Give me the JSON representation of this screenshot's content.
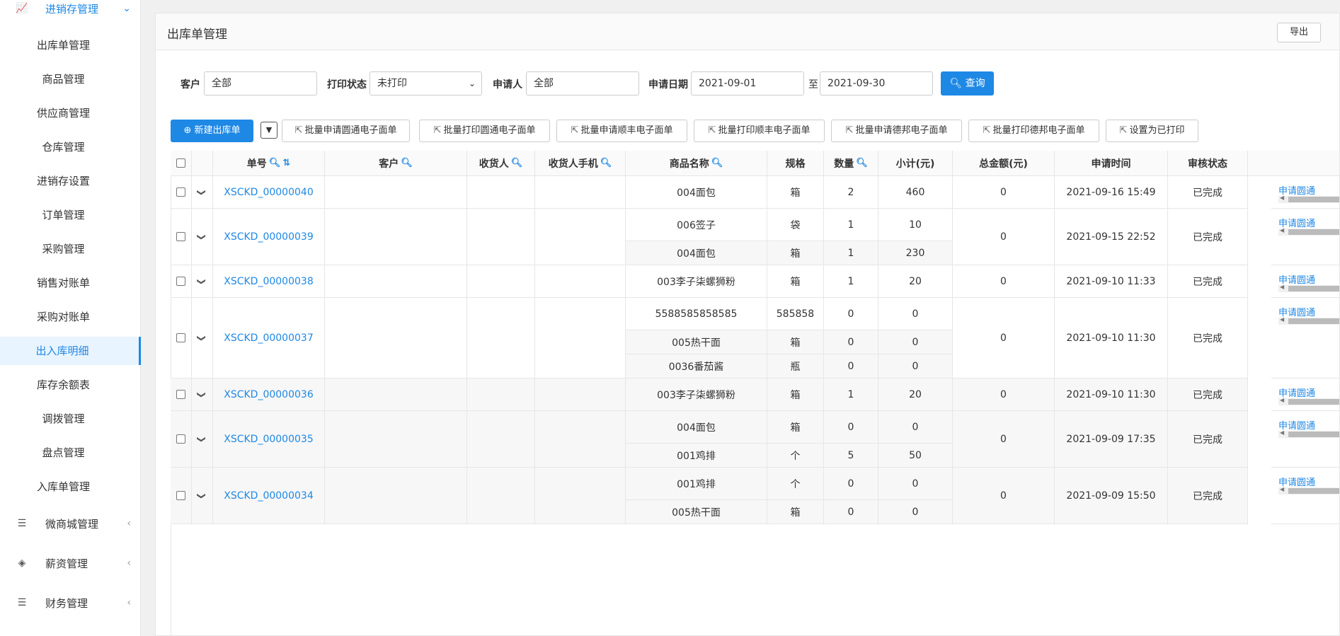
{
  "sidebar": {
    "top_group": {
      "label": "进销存管理",
      "icon": "chart-line-icon"
    },
    "items": [
      {
        "label": "出库单管理"
      },
      {
        "label": "商品管理"
      },
      {
        "label": "供应商管理"
      },
      {
        "label": "仓库管理"
      },
      {
        "label": "进销存设置"
      },
      {
        "label": "订单管理"
      },
      {
        "label": "采购管理"
      },
      {
        "label": "销售对账单"
      },
      {
        "label": "采购对账单"
      },
      {
        "label": "出入库明细",
        "active": true
      },
      {
        "label": "库存余额表"
      },
      {
        "label": "调拨管理"
      },
      {
        "label": "盘点管理"
      },
      {
        "label": "入库单管理"
      }
    ],
    "groups": [
      {
        "label": "微商城管理",
        "icon": "list-icon"
      },
      {
        "label": "薪资管理",
        "icon": "box-icon"
      },
      {
        "label": "财务管理",
        "icon": "list-icon"
      }
    ]
  },
  "panel": {
    "title": "出库单管理",
    "export_label": "导出"
  },
  "filters": {
    "customer_label": "客户",
    "customer_value": "全部",
    "print_label": "打印状态",
    "print_value": "未打印",
    "applicant_label": "申请人",
    "applicant_value": "全部",
    "date_label": "申请日期",
    "date_from": "2021-09-01",
    "date_to_label": "至",
    "date_to": "2021-09-30",
    "query_label": "查询"
  },
  "actions": {
    "new_label": "新建出库单",
    "buttons": [
      "批量申请圆通电子面单",
      "批量打印圆通电子面单",
      "批量申请顺丰电子面单",
      "批量打印顺丰电子面单",
      "批量申请德邦电子面单",
      "批量打印德邦电子面单",
      "设置为已打印"
    ]
  },
  "table": {
    "headers": {
      "no": "单号",
      "customer": "客户",
      "receiver": "收货人",
      "phone": "收货人手机",
      "product": "商品名称",
      "spec": "规格",
      "qty": "数量",
      "subtotal": "小计(元)",
      "total": "总金额(元)",
      "time": "申请时间",
      "status": "审核状态"
    },
    "op_label": "申请圆通",
    "rows": [
      {
        "no": "XSCKD_00000040",
        "total": "0",
        "time": "2021-09-16 15:49",
        "status": "已完成",
        "items": [
          {
            "name": "004面包",
            "spec": "箱",
            "qty": "2",
            "sub": "460"
          }
        ]
      },
      {
        "no": "XSCKD_00000039",
        "total": "0",
        "time": "2021-09-15 22:52",
        "status": "已完成",
        "items": [
          {
            "name": "006签子",
            "spec": "袋",
            "qty": "1",
            "sub": "10"
          },
          {
            "name": "004面包",
            "spec": "箱",
            "qty": "1",
            "sub": "230"
          }
        ]
      },
      {
        "no": "XSCKD_00000038",
        "total": "0",
        "time": "2021-09-10 11:33",
        "status": "已完成",
        "items": [
          {
            "name": "003李子柒螺狮粉",
            "spec": "箱",
            "qty": "1",
            "sub": "20"
          }
        ]
      },
      {
        "no": "XSCKD_00000037",
        "total": "0",
        "time": "2021-09-10 11:30",
        "status": "已完成",
        "items": [
          {
            "name": "5588585858585",
            "spec": "585858",
            "qty": "0",
            "sub": "0"
          },
          {
            "name": "005热干面",
            "spec": "箱",
            "qty": "0",
            "sub": "0"
          },
          {
            "name": "0036番茄酱",
            "spec": "瓶",
            "qty": "0",
            "sub": "0"
          }
        ]
      },
      {
        "no": "XSCKD_00000036",
        "total": "0",
        "time": "2021-09-10 11:30",
        "status": "已完成",
        "items": [
          {
            "name": "003李子柒螺狮粉",
            "spec": "箱",
            "qty": "1",
            "sub": "20"
          }
        ]
      },
      {
        "no": "XSCKD_00000035",
        "total": "0",
        "time": "2021-09-09 17:35",
        "status": "已完成",
        "items": [
          {
            "name": "004面包",
            "spec": "箱",
            "qty": "0",
            "sub": "0"
          },
          {
            "name": "001鸡排",
            "spec": "个",
            "qty": "5",
            "sub": "50"
          }
        ]
      },
      {
        "no": "XSCKD_00000034",
        "total": "0",
        "time": "2021-09-09 15:50",
        "status": "已完成",
        "items": [
          {
            "name": "001鸡排",
            "spec": "个",
            "qty": "0",
            "sub": "0"
          },
          {
            "name": "005热干面",
            "spec": "箱",
            "qty": "0",
            "sub": "0"
          }
        ]
      }
    ]
  }
}
